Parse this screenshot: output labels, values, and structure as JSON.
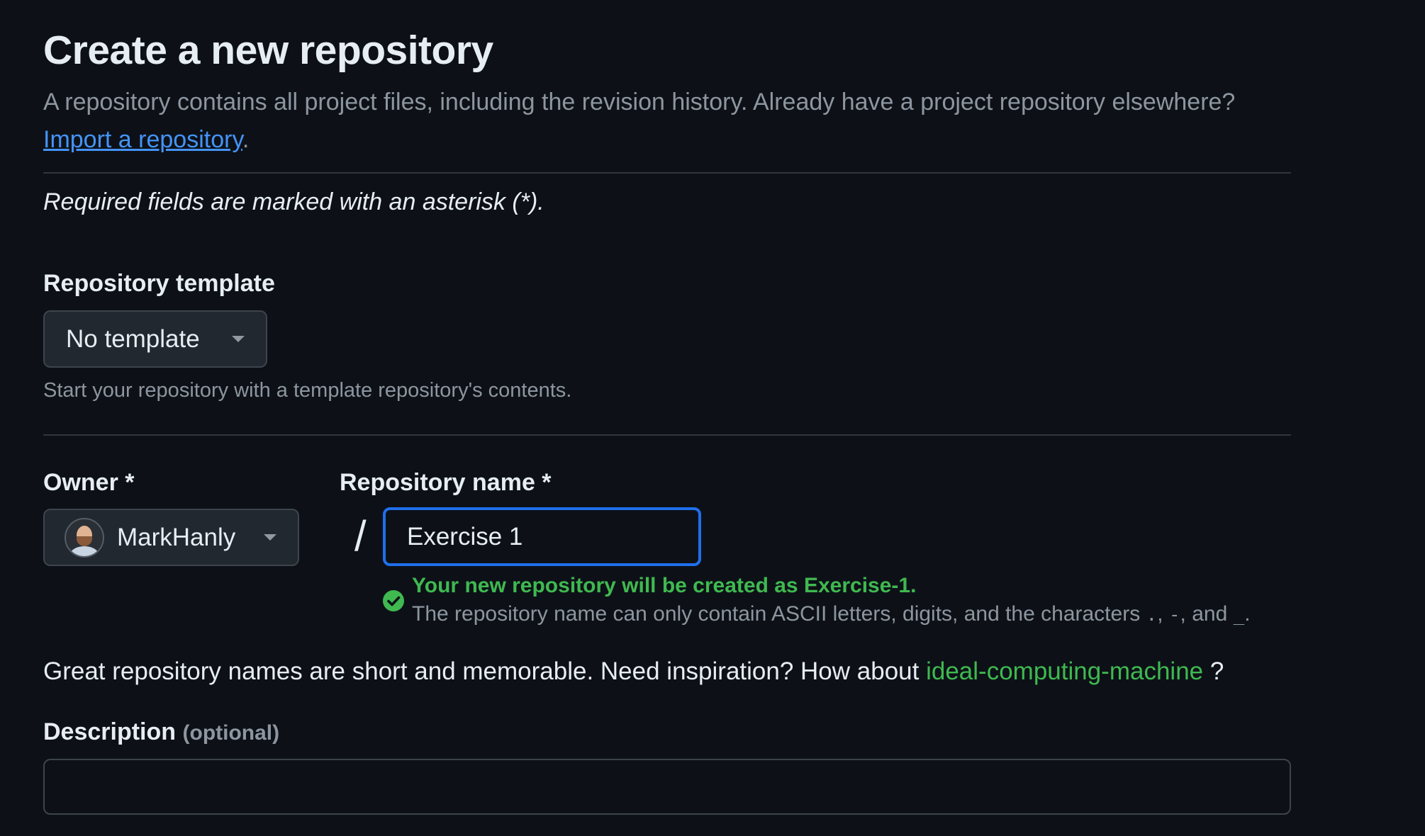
{
  "page": {
    "title": "Create a new repository",
    "intro_text": "A repository contains all project files, including the revision history. Already have a project repository elsewhere?",
    "import_link": "Import a repository",
    "intro_end": ".",
    "required_note": "Required fields are marked with an asterisk (*)."
  },
  "template": {
    "label": "Repository template",
    "selected": "No template",
    "hint": "Start your repository with a template repository's contents."
  },
  "owner": {
    "label": "Owner *",
    "selected": "MarkHanly"
  },
  "separator": "/",
  "repo_name": {
    "label": "Repository name *",
    "value": "Exercise 1",
    "validation_title": "Your new repository will be created as Exercise-1.",
    "validation_detail_prefix": "The repository name can only contain ASCII letters, digits, and the characters",
    "char_dot": ".",
    "char_dash": "-",
    "and_text": ", and",
    "char_underscore": "_",
    "end_period": "."
  },
  "inspiration": {
    "text": "Great repository names are short and memorable. Need inspiration? How about",
    "suggestion": "ideal-computing-machine",
    "end": "?"
  },
  "description": {
    "label": "Description",
    "optional": "(optional)",
    "value": ""
  },
  "colors": {
    "background": "#0d1117",
    "accent_blue": "#1f6feb",
    "link": "#4493f8",
    "success": "#3fb950",
    "muted": "#8d96a0"
  },
  "icons": {
    "dropdown": "caret-down-icon",
    "valid": "check-circle-icon",
    "owner_avatar": "avatar"
  }
}
